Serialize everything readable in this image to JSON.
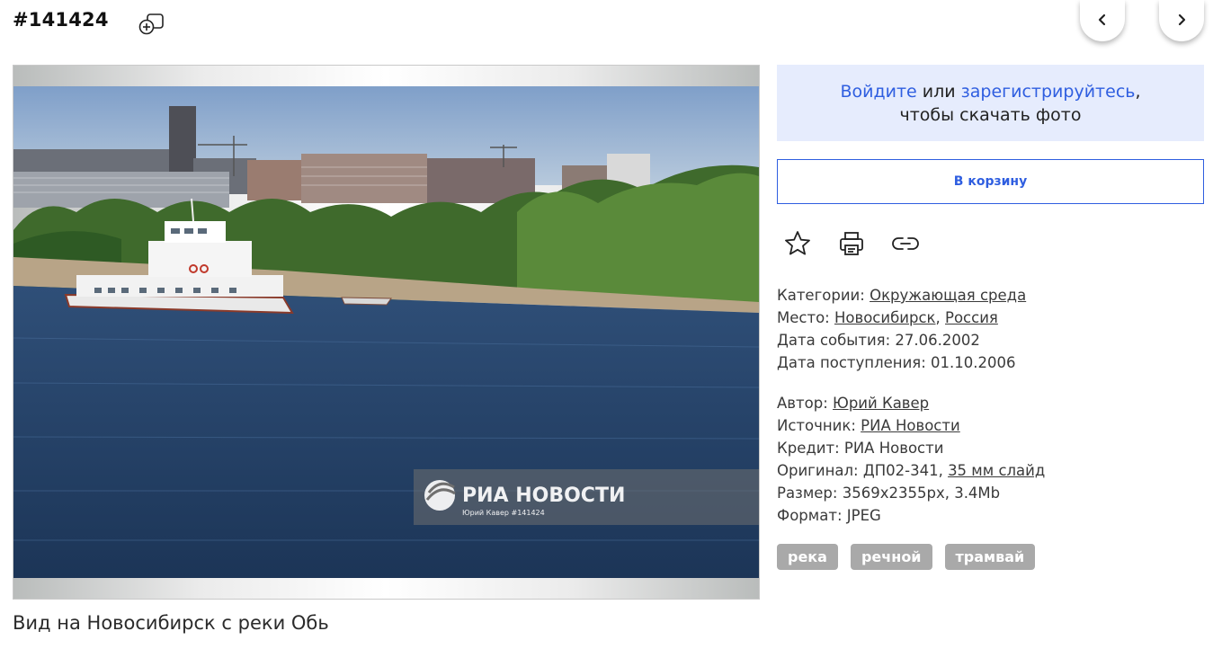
{
  "header": {
    "photo_id": "#141424",
    "add_icon": "add-to-collection-icon",
    "prev_icon": "chevron-left-icon",
    "next_icon": "chevron-right-icon"
  },
  "photo": {
    "watermark_brand": "РИА НОВОСТИ",
    "watermark_credit": "Юрий Кавер #141424",
    "caption": "Вид на Новосибирск с реки Обь"
  },
  "login": {
    "login_link": "Войдите",
    "or_text": " или ",
    "register_link": "зарегистрируйтесь",
    "comma": ",",
    "line2": "чтобы скачать фото"
  },
  "cart": {
    "label": "В корзину"
  },
  "actions": [
    "star-icon",
    "print-icon",
    "link-icon"
  ],
  "meta": {
    "categories_label": "Категории: ",
    "categories_value": "Окружающая среда",
    "place_label": "Место: ",
    "place_city": "Новосибирск",
    "place_sep": ", ",
    "place_country": "Россия",
    "event_date_label": "Дата события: ",
    "event_date": "27.06.2002",
    "received_label": "Дата поступления: ",
    "received_date": "01.10.2006",
    "author_label": "Автор: ",
    "author": "Юрий Кавер",
    "source_label": "Источник: ",
    "source": "РИА Новости",
    "credit_label": "Кредит: ",
    "credit": "РИА Новости",
    "original_label": "Оригинал: ",
    "original_code": "ДП02-341, ",
    "original_media": "35 мм слайд",
    "size_label": "Размер: ",
    "size": "3569x2355px, 3.4Mb",
    "format_label": "Формат: ",
    "format": "JPEG"
  },
  "tags": [
    "река",
    "речной",
    "трамвай"
  ],
  "colors": {
    "accent_blue": "#2f5ee0",
    "login_bg": "#e6ecfd",
    "tag_bg": "#a9a9a9"
  }
}
